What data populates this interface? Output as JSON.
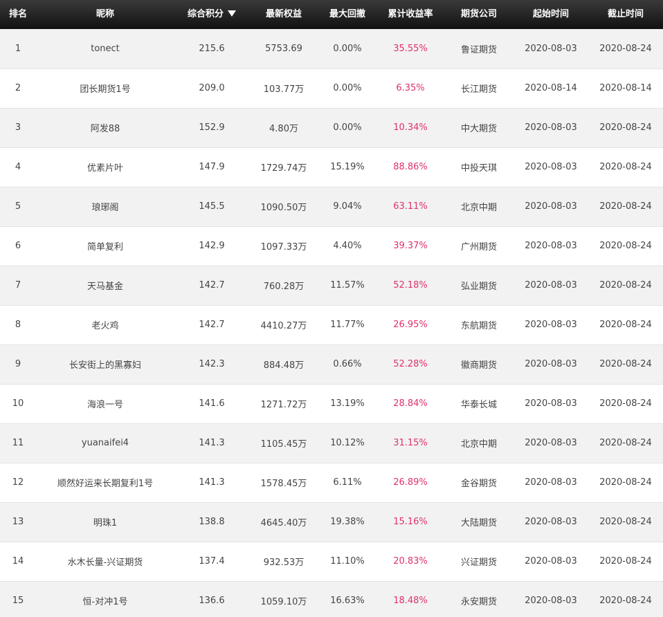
{
  "columns": [
    {
      "key": "rank",
      "label": "排名"
    },
    {
      "key": "nickname",
      "label": "昵称"
    },
    {
      "key": "score",
      "label": "综合积分"
    },
    {
      "key": "equity",
      "label": "最新权益"
    },
    {
      "key": "drawdown",
      "label": "最大回撤"
    },
    {
      "key": "return",
      "label": "累计收益率"
    },
    {
      "key": "company",
      "label": "期货公司"
    },
    {
      "key": "start",
      "label": "起始时间"
    },
    {
      "key": "end",
      "label": "截止时间"
    }
  ],
  "sort": {
    "column": "score",
    "direction": "desc",
    "icon": "sort-desc-icon"
  },
  "colors": {
    "header_bg": "#1a1a1a",
    "row_alt": "#f2f2f2",
    "return_text": "#e0306e"
  },
  "rows": [
    {
      "rank": "1",
      "nickname": "tonect",
      "score": "215.6",
      "equity": "5753.69",
      "drawdown": "0.00%",
      "return": "35.55%",
      "company": "鲁证期货",
      "start": "2020-08-03",
      "end": "2020-08-24"
    },
    {
      "rank": "2",
      "nickname": "团长期货1号",
      "score": "209.0",
      "equity": "103.77万",
      "drawdown": "0.00%",
      "return": "6.35%",
      "company": "长江期货",
      "start": "2020-08-14",
      "end": "2020-08-14"
    },
    {
      "rank": "3",
      "nickname": "阿发88",
      "score": "152.9",
      "equity": "4.80万",
      "drawdown": "0.00%",
      "return": "10.34%",
      "company": "中大期货",
      "start": "2020-08-03",
      "end": "2020-08-24"
    },
    {
      "rank": "4",
      "nickname": "优素片叶",
      "score": "147.9",
      "equity": "1729.74万",
      "drawdown": "15.19%",
      "return": "88.86%",
      "company": "中投天琪",
      "start": "2020-08-03",
      "end": "2020-08-24"
    },
    {
      "rank": "5",
      "nickname": "琅琊阁",
      "score": "145.5",
      "equity": "1090.50万",
      "drawdown": "9.04%",
      "return": "63.11%",
      "company": "北京中期",
      "start": "2020-08-03",
      "end": "2020-08-24"
    },
    {
      "rank": "6",
      "nickname": "简单复利",
      "score": "142.9",
      "equity": "1097.33万",
      "drawdown": "4.40%",
      "return": "39.37%",
      "company": "广州期货",
      "start": "2020-08-03",
      "end": "2020-08-24"
    },
    {
      "rank": "7",
      "nickname": "天马基金",
      "score": "142.7",
      "equity": "760.28万",
      "drawdown": "11.57%",
      "return": "52.18%",
      "company": "弘业期货",
      "start": "2020-08-03",
      "end": "2020-08-24"
    },
    {
      "rank": "8",
      "nickname": "老火鸡",
      "score": "142.7",
      "equity": "4410.27万",
      "drawdown": "11.77%",
      "return": "26.95%",
      "company": "东航期货",
      "start": "2020-08-03",
      "end": "2020-08-24"
    },
    {
      "rank": "9",
      "nickname": "长安街上的黑寡妇",
      "score": "142.3",
      "equity": "884.48万",
      "drawdown": "0.66%",
      "return": "52.28%",
      "company": "徽商期货",
      "start": "2020-08-03",
      "end": "2020-08-24"
    },
    {
      "rank": "10",
      "nickname": "海浪一号",
      "score": "141.6",
      "equity": "1271.72万",
      "drawdown": "13.19%",
      "return": "28.84%",
      "company": "华泰长城",
      "start": "2020-08-03",
      "end": "2020-08-24"
    },
    {
      "rank": "11",
      "nickname": "yuanaifei4",
      "score": "141.3",
      "equity": "1105.45万",
      "drawdown": "10.12%",
      "return": "31.15%",
      "company": "北京中期",
      "start": "2020-08-03",
      "end": "2020-08-24"
    },
    {
      "rank": "12",
      "nickname": "顺然好运来长期复利1号",
      "score": "141.3",
      "equity": "1578.45万",
      "drawdown": "6.11%",
      "return": "26.89%",
      "company": "金谷期货",
      "start": "2020-08-03",
      "end": "2020-08-24"
    },
    {
      "rank": "13",
      "nickname": "明珠1",
      "score": "138.8",
      "equity": "4645.40万",
      "drawdown": "19.38%",
      "return": "15.16%",
      "company": "大陆期货",
      "start": "2020-08-03",
      "end": "2020-08-24"
    },
    {
      "rank": "14",
      "nickname": "水木长量-兴证期货",
      "score": "137.4",
      "equity": "932.53万",
      "drawdown": "11.10%",
      "return": "20.83%",
      "company": "兴证期货",
      "start": "2020-08-03",
      "end": "2020-08-24"
    },
    {
      "rank": "15",
      "nickname": "恒-对冲1号",
      "score": "136.6",
      "equity": "1059.10万",
      "drawdown": "16.63%",
      "return": "18.48%",
      "company": "永安期货",
      "start": "2020-08-03",
      "end": "2020-08-24"
    }
  ]
}
